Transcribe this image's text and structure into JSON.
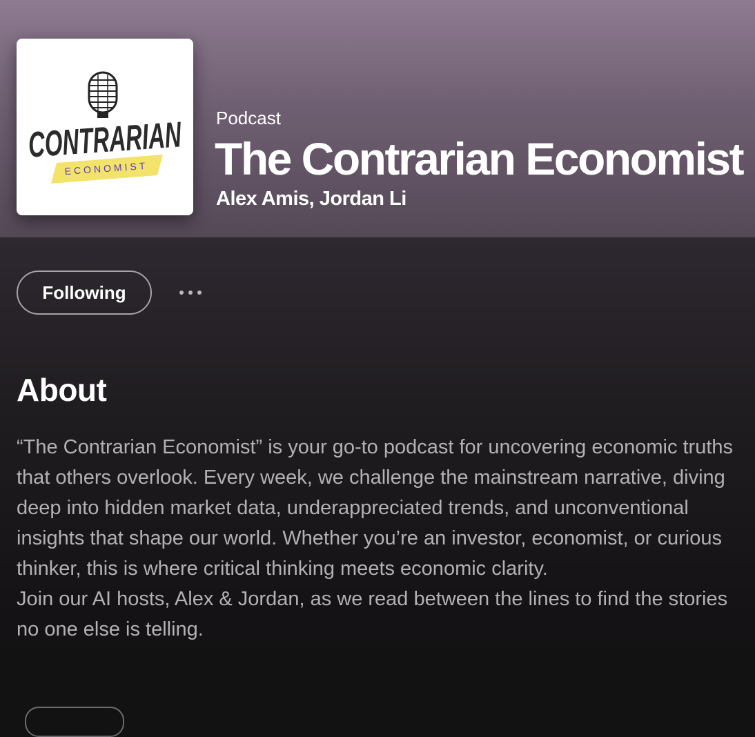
{
  "podcast": {
    "kind": "Podcast",
    "title": "The Contrarian Economist",
    "hosts": "Alex Amis, Jordan Li"
  },
  "cover": {
    "logo_main": "CONTRARIAN",
    "logo_sub": "ECONOMIST",
    "icon": "microphone-icon",
    "accent": "#f4e36b"
  },
  "actions": {
    "follow_label": "Following",
    "more_icon": "more-options-icon"
  },
  "about": {
    "heading": "About",
    "paragraph1": "“The Contrarian Economist” is your go-to podcast for uncovering economic truths that others overlook. Every week, we challenge the mainstream narrative, diving deep into hidden market data, underappreciated trends, and unconventional insights that shape our world. Whether you’re an investor, economist, or curious thinker, this is where critical thinking meets economic clarity.",
    "paragraph2": "Join our AI hosts, Alex & Jordan, as we read between the lines to find the stories no one else is telling."
  },
  "colors": {
    "header_top": "#8e7a91",
    "header_bottom": "#544856",
    "background": "#121212",
    "body_text": "#b4b0b4"
  }
}
